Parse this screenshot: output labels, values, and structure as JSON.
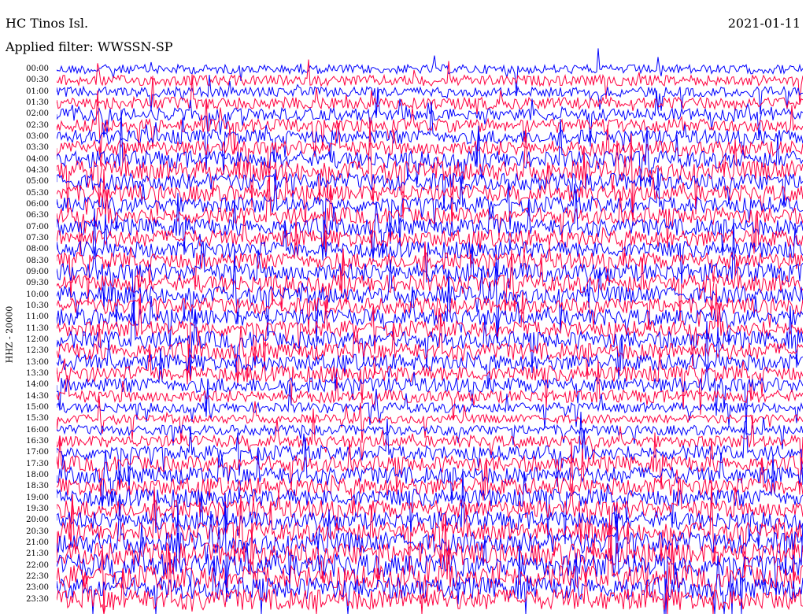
{
  "header": {
    "station": "HC Tinos Isl.",
    "date": "2021-01-11",
    "filter": "Applied filter: WWSSN-SP"
  },
  "chart_data": {
    "type": "line",
    "title": "HC Tinos Isl.",
    "ylabel": "HHZ - 20000",
    "time_labels": [
      "00:00",
      "00:30",
      "01:00",
      "01:30",
      "02:00",
      "02:30",
      "03:00",
      "03:30",
      "04:00",
      "04:30",
      "05:00",
      "05:30",
      "06:00",
      "06:30",
      "07:00",
      "07:30",
      "08:00",
      "08:30",
      "09:00",
      "09:30",
      "10:00",
      "10:30",
      "11:00",
      "11:30",
      "12:00",
      "12:30",
      "13:00",
      "13:30",
      "14:00",
      "14:30",
      "15:00",
      "15:30",
      "16:00",
      "16:30",
      "17:00",
      "17:30",
      "18:00",
      "18:30",
      "19:00",
      "19:30",
      "20:00",
      "20:30",
      "21:00",
      "21:30",
      "22:00",
      "22:30",
      "23:00",
      "23:30"
    ],
    "trace_colors": [
      "#0000ff",
      "#ff0040"
    ],
    "amplitude": [
      1.4,
      1.6,
      1.5,
      1.8,
      1.9,
      2.0,
      2.2,
      2.3,
      2.6,
      3.0,
      2.6,
      2.5,
      2.4,
      2.5,
      2.6,
      2.6,
      2.5,
      2.6,
      2.8,
      2.7,
      2.6,
      2.4,
      2.5,
      2.4,
      2.6,
      2.6,
      2.5,
      2.4,
      2.3,
      1.9,
      1.5,
      1.3,
      1.5,
      1.8,
      2.2,
      2.4,
      2.6,
      2.7,
      2.7,
      2.8,
      2.7,
      2.9,
      3.2,
      3.4,
      3.5,
      3.5,
      3.3,
      3.2
    ]
  }
}
